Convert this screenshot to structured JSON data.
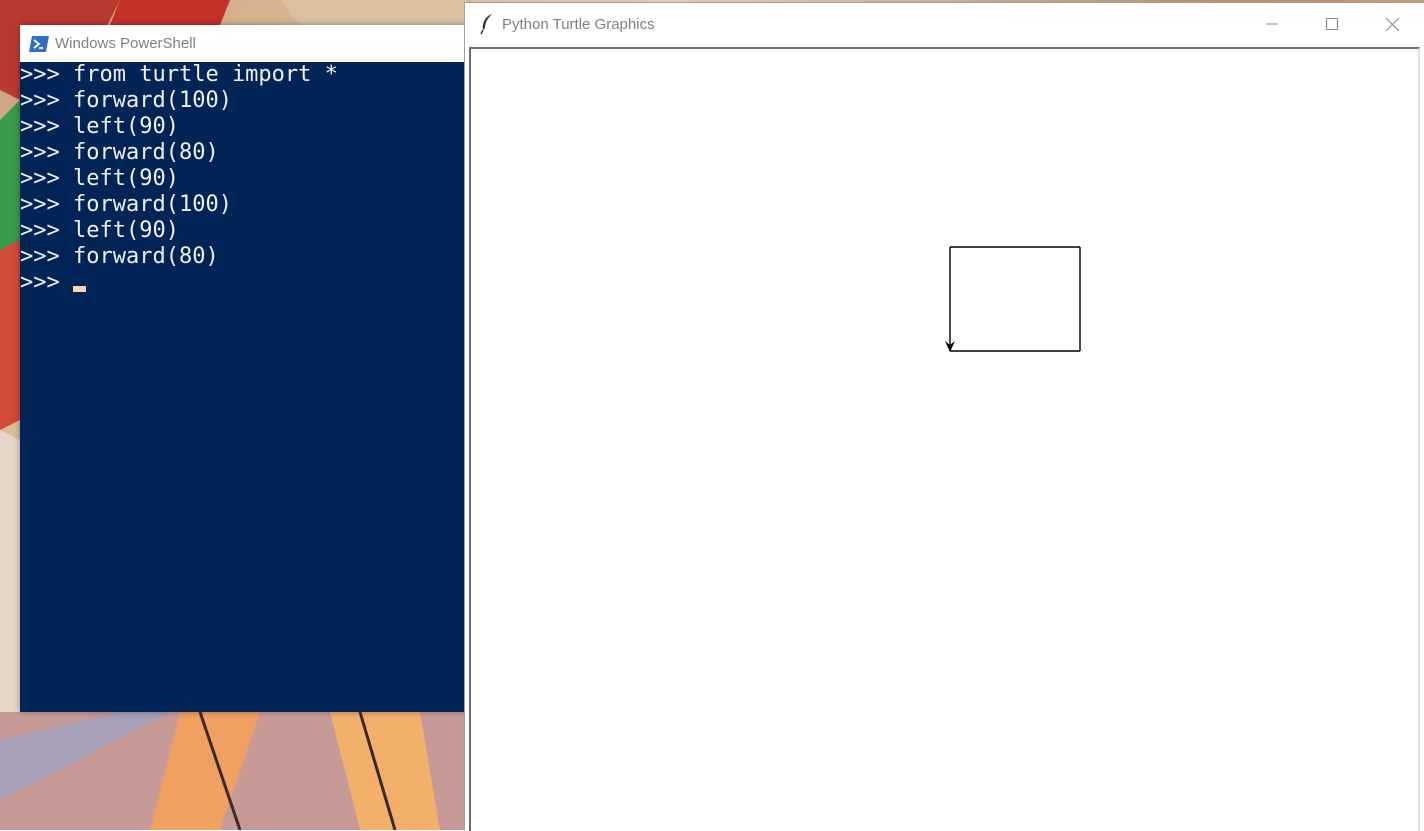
{
  "powershell": {
    "title": "Windows PowerShell",
    "icon": "powershell-icon",
    "background": "#012456",
    "prompt": ">>>",
    "lines": [
      {
        "prompt": ">>>",
        "command": "from turtle import *"
      },
      {
        "prompt": ">>>",
        "command": "forward(100)"
      },
      {
        "prompt": ">>>",
        "command": "left(90)"
      },
      {
        "prompt": ">>>",
        "command": "forward(80)"
      },
      {
        "prompt": ">>>",
        "command": "left(90)"
      },
      {
        "prompt": ">>>",
        "command": "forward(100)"
      },
      {
        "prompt": ">>>",
        "command": "left(90)"
      },
      {
        "prompt": ">>>",
        "command": "forward(80)"
      }
    ],
    "current_prompt": ">>>",
    "current_input": ""
  },
  "turtle": {
    "title": "Python Turtle Graphics",
    "icon": "feather-icon",
    "controls": {
      "minimize": "minimize-icon",
      "maximize": "maximize-icon",
      "close": "close-icon"
    },
    "drawing": {
      "unit_scale": 1.3,
      "commands": [
        {
          "cmd": "forward",
          "value": 100
        },
        {
          "cmd": "left",
          "value": 90
        },
        {
          "cmd": "forward",
          "value": 80
        },
        {
          "cmd": "left",
          "value": 90
        },
        {
          "cmd": "forward",
          "value": 100
        },
        {
          "cmd": "left",
          "value": 90
        },
        {
          "cmd": "forward",
          "value": 80
        }
      ],
      "pen_color": "#000000",
      "turtle_shape": "classic-arrow",
      "turtle_heading_deg": 270
    }
  }
}
